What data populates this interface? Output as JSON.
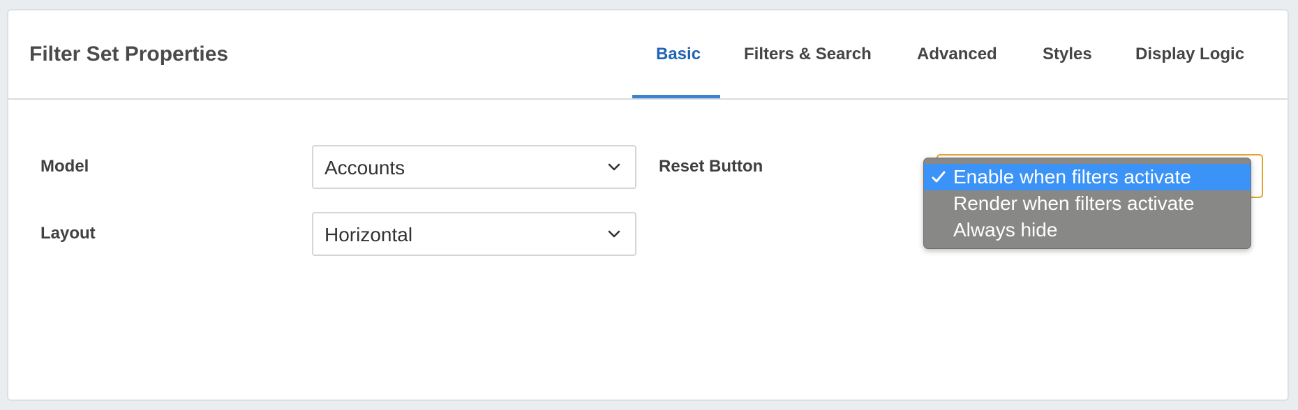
{
  "header": {
    "title": "Filter Set Properties",
    "tabs": [
      {
        "label": "Basic",
        "active": true
      },
      {
        "label": "Filters & Search",
        "active": false
      },
      {
        "label": "Advanced",
        "active": false
      },
      {
        "label": "Styles",
        "active": false
      },
      {
        "label": "Display Logic",
        "active": false
      }
    ]
  },
  "form": {
    "model": {
      "label": "Model",
      "value": "Accounts"
    },
    "layout": {
      "label": "Layout",
      "value": "Horizontal"
    },
    "reset_button": {
      "label": "Reset Button",
      "options": [
        {
          "label": "Enable when filters activate",
          "selected": true
        },
        {
          "label": "Render when filters activate",
          "selected": false
        },
        {
          "label": "Always hide",
          "selected": false
        }
      ]
    }
  },
  "colors": {
    "active_tab": "#1f63b3",
    "tab_underline": "#3a84cf",
    "focus_border": "#e0a334",
    "dropdown_bg": "#888886",
    "dropdown_highlight": "#3b92f7"
  },
  "icons": {
    "select_chevron": "chevron-down-icon",
    "selected_option": "checkmark-icon"
  }
}
